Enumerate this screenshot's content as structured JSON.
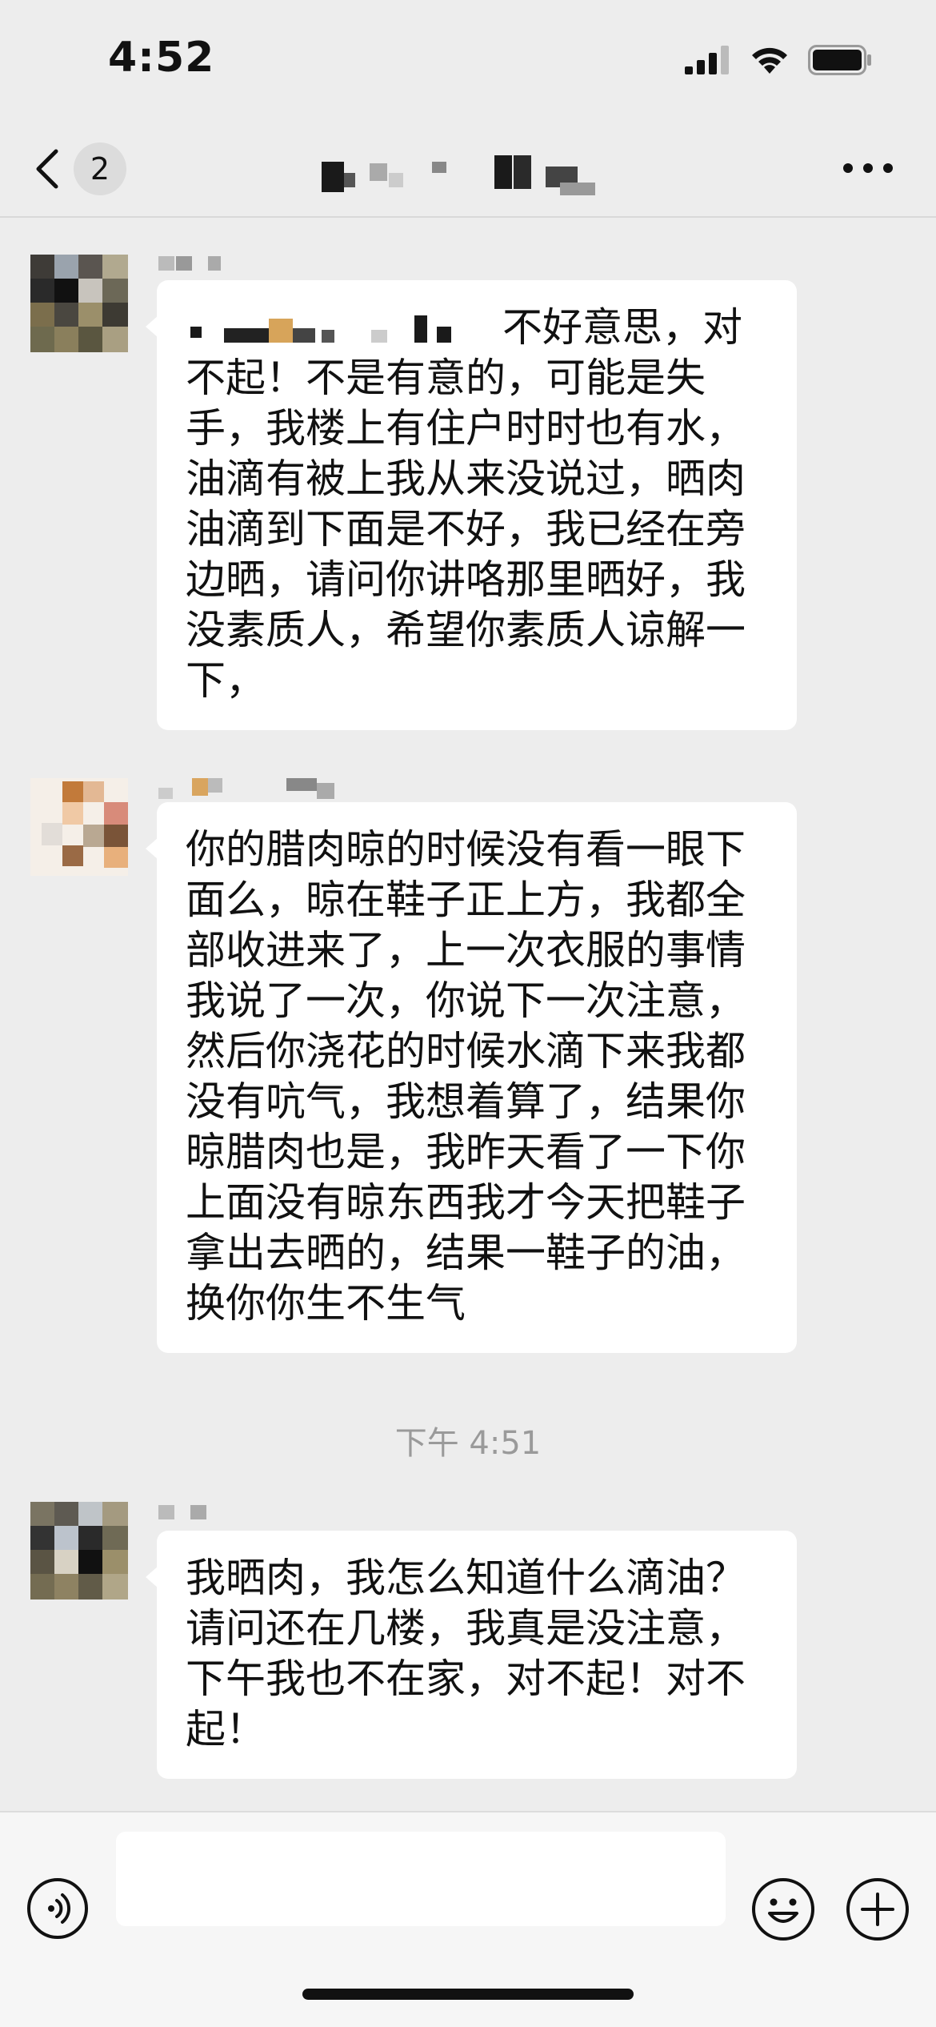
{
  "status_bar": {
    "time": "4:52",
    "icons": [
      "cellular-signal-icon",
      "wifi-icon",
      "battery-icon"
    ]
  },
  "nav": {
    "back_icon": "chevron-left-icon",
    "unread_count": "2",
    "title": "",
    "more_icon": "more-dots-icon"
  },
  "messages": [
    {
      "side": "left",
      "sender_name": "",
      "text": "不好意思，对不起！不是有意的，可能是失手，我楼上有住户时时也有水，油滴有被上我从来没说过，晒肉油滴到下面是不好，我已经在旁边晒，请问你讲咯那里晒好，我没素质人，希望你素质人谅解一下，"
    },
    {
      "side": "left",
      "sender_name": "",
      "text": "你的腊肉晾的时候没有看一眼下面么，晾在鞋子正上方，我都全部收进来了，上一次衣服的事情我说了一次，你说下一次注意，然后你浇花的时候水滴下来我都没有吭气，我想着算了，结果你晾腊肉也是，我昨天看了一下你上面没有晾东西我才今天把鞋子拿出去晒的，结果一鞋子的油，换你你生不生气"
    },
    {
      "side": "left",
      "sender_name": "",
      "text": "我晒肉，我怎么知道什么滴油？请问还在几楼，我真是没注意，下午我也不在家，对不起！对不起！"
    }
  ],
  "timestamp": "下午 4:51",
  "input_bar": {
    "voice_icon": "voice-icon",
    "emoji_icon": "emoji-icon",
    "plus_icon": "plus-icon",
    "text_value": ""
  },
  "colors": {
    "background": "#ededed",
    "bubble": "#ffffff",
    "timestamp": "#9a9a9a",
    "input_bar": "#f6f6f6"
  }
}
